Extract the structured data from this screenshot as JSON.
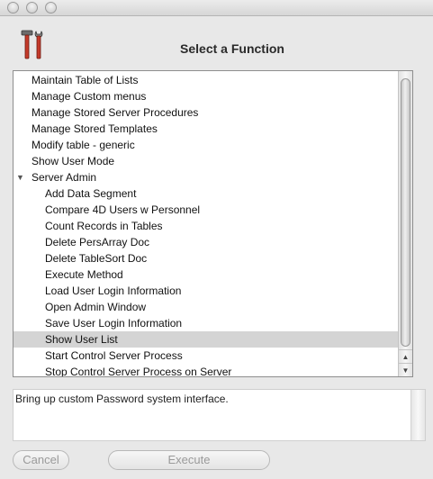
{
  "window": {
    "title": "Select a Function",
    "controls": [
      "close",
      "minimize",
      "zoom"
    ]
  },
  "icon": "tools-icon",
  "function_list": {
    "items": [
      {
        "label": "Maintain Table of Lists",
        "level": 0
      },
      {
        "label": "Manage Custom menus",
        "level": 0
      },
      {
        "label": "Manage Stored Server Procedures",
        "level": 0
      },
      {
        "label": "Manage Stored Templates",
        "level": 0
      },
      {
        "label": "Modify table - generic",
        "level": 0
      },
      {
        "label": "Show User Mode",
        "level": 0
      },
      {
        "label": "Server Admin",
        "level": 0,
        "expanded": true
      },
      {
        "label": "Add Data Segment",
        "level": 1
      },
      {
        "label": "Compare 4D Users w Personnel",
        "level": 1
      },
      {
        "label": "Count Records in Tables",
        "level": 1
      },
      {
        "label": "Delete PersArray Doc",
        "level": 1
      },
      {
        "label": "Delete TableSort Doc",
        "level": 1
      },
      {
        "label": "Execute Method",
        "level": 1
      },
      {
        "label": "Load User Login Information",
        "level": 1
      },
      {
        "label": "Open Admin Window",
        "level": 1
      },
      {
        "label": "Save User Login Information",
        "level": 1
      },
      {
        "label": "Show User List",
        "level": 1,
        "selected": true
      },
      {
        "label": "Start Control Server Process",
        "level": 1
      },
      {
        "label": "Stop Control Server Process on Server",
        "level": 1
      }
    ]
  },
  "description": {
    "text": "Bring up custom Password system interface."
  },
  "buttons": {
    "cancel": "Cancel",
    "execute": "Execute"
  },
  "colors": {
    "selection": "#d4d4d4",
    "disabled_text": "#9a9a9a"
  }
}
